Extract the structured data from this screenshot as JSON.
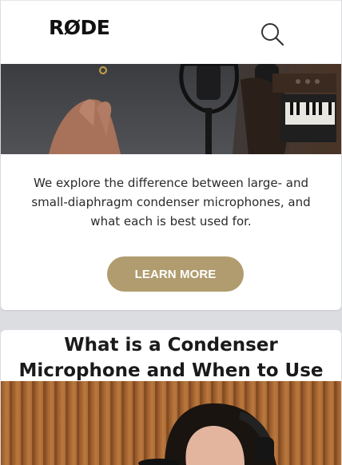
{
  "header": {
    "logo_text": "RØDE",
    "search_icon": "search-icon"
  },
  "promo_card": {
    "image_alt": "Person playing keyboard with a condenser microphone in a studio",
    "description": "We explore the difference between large- and small-diaphragm condenser microphones, and what each is best used for.",
    "cta_label": "LEARN MORE"
  },
  "article": {
    "title": "What is a Condenser Microphone and When to Use One",
    "image_alt": "Woman wearing headphones in front of wood paneling"
  },
  "colors": {
    "page_bg": "#dcdde1",
    "cta_bg": "#b09c6e",
    "card_bg": "#ffffff",
    "text": "#2a2a2a"
  }
}
